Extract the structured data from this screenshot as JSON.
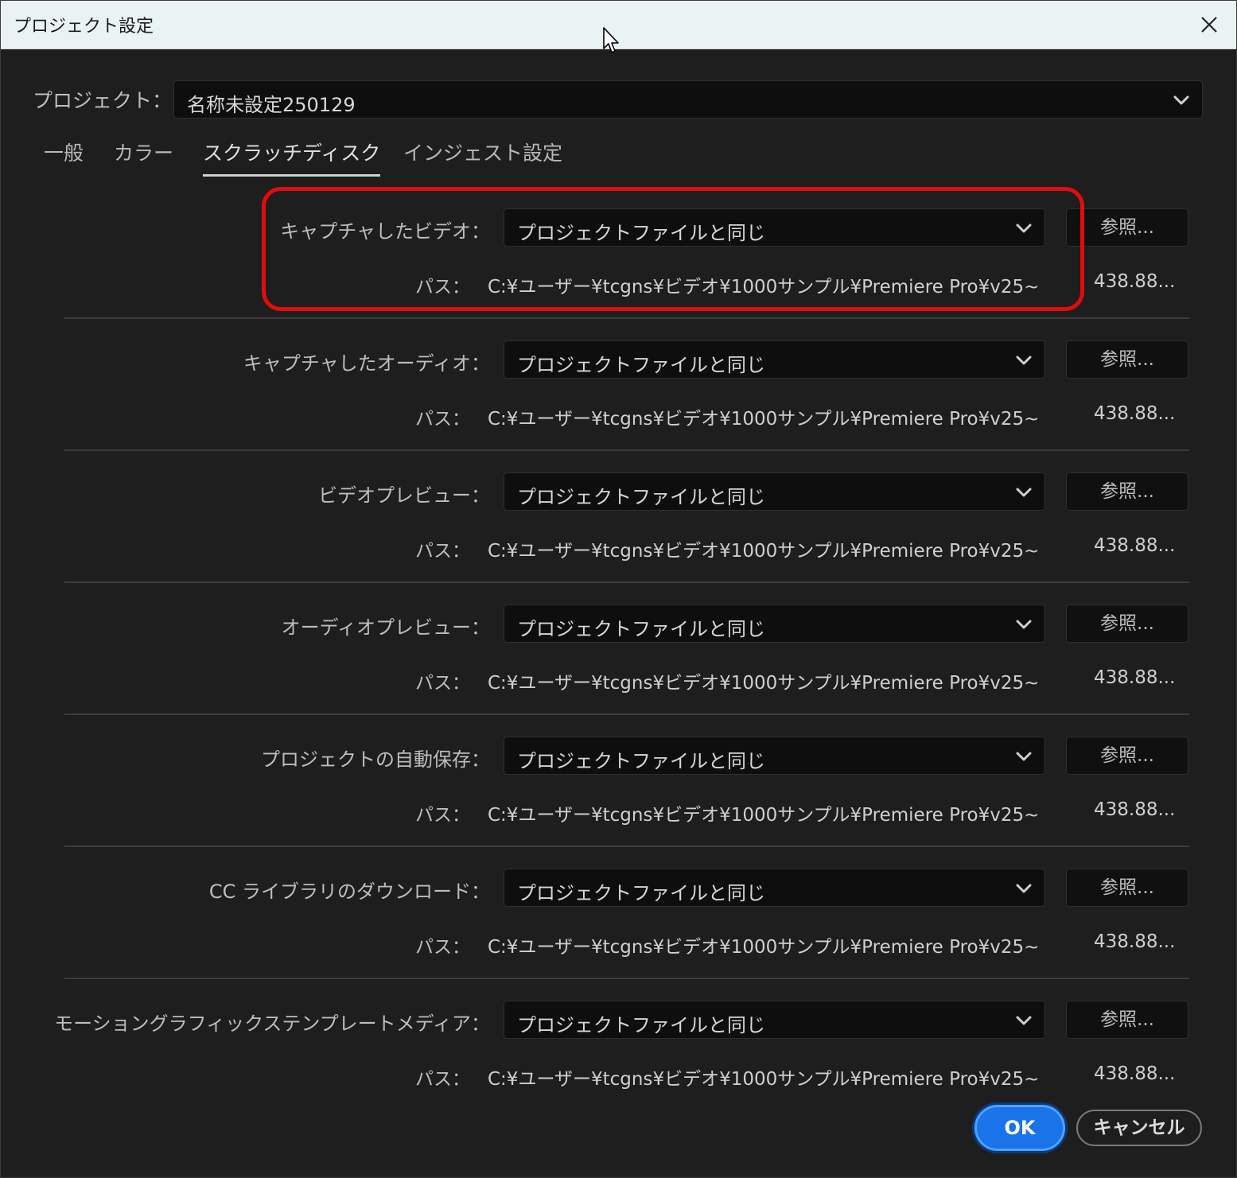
{
  "window": {
    "title": "プロジェクト設定"
  },
  "project": {
    "label": "プロジェクト：",
    "value": "名称未設定250129"
  },
  "tabs": [
    {
      "label": "一般",
      "active": false
    },
    {
      "label": "カラー",
      "active": false
    },
    {
      "label": "スクラッチディスク",
      "active": true
    },
    {
      "label": "インジェスト設定",
      "active": false
    }
  ],
  "rows": [
    {
      "label": "キャプチャしたビデオ：",
      "select_value": "プロジェクトファイルと同じ",
      "browse_label": "参照...",
      "path_label": "パス：",
      "path": "C:¥ユーザー¥tcgns¥ビデオ¥1000サンプル¥Premiere Pro¥v25~",
      "size": "438.88..."
    },
    {
      "label": "キャプチャしたオーディオ：",
      "select_value": "プロジェクトファイルと同じ",
      "browse_label": "参照...",
      "path_label": "パス：",
      "path": "C:¥ユーザー¥tcgns¥ビデオ¥1000サンプル¥Premiere Pro¥v25~",
      "size": "438.88..."
    },
    {
      "label": "ビデオプレビュー：",
      "select_value": "プロジェクトファイルと同じ",
      "browse_label": "参照...",
      "path_label": "パス：",
      "path": "C:¥ユーザー¥tcgns¥ビデオ¥1000サンプル¥Premiere Pro¥v25~",
      "size": "438.88..."
    },
    {
      "label": "オーディオプレビュー：",
      "select_value": "プロジェクトファイルと同じ",
      "browse_label": "参照...",
      "path_label": "パス：",
      "path": "C:¥ユーザー¥tcgns¥ビデオ¥1000サンプル¥Premiere Pro¥v25~",
      "size": "438.88..."
    },
    {
      "label": "プロジェクトの自動保存：",
      "select_value": "プロジェクトファイルと同じ",
      "browse_label": "参照...",
      "path_label": "パス：",
      "path": "C:¥ユーザー¥tcgns¥ビデオ¥1000サンプル¥Premiere Pro¥v25~",
      "size": "438.88..."
    },
    {
      "label": "CC ライブラリのダウンロード：",
      "select_value": "プロジェクトファイルと同じ",
      "browse_label": "参照...",
      "path_label": "パス：",
      "path": "C:¥ユーザー¥tcgns¥ビデオ¥1000サンプル¥Premiere Pro¥v25~",
      "size": "438.88..."
    },
    {
      "label": "モーショングラフィックステンプレートメディア：",
      "select_value": "プロジェクトファイルと同じ",
      "browse_label": "参照...",
      "path_label": "パス：",
      "path": "C:¥ユーザー¥tcgns¥ビデオ¥1000サンプル¥Premiere Pro¥v25~",
      "size": "438.88..."
    }
  ],
  "footer": {
    "ok_label": "OK",
    "cancel_label": "キャンセル"
  },
  "icons": {
    "close": "close-icon",
    "dropdown": "chevron-down-icon",
    "cursor": "mouse-cursor-icon"
  },
  "colors": {
    "accent": "#1a73e8",
    "highlight": "#e00d0d",
    "background": "#1e1e1e",
    "titlebar": "#eaf3f4"
  }
}
